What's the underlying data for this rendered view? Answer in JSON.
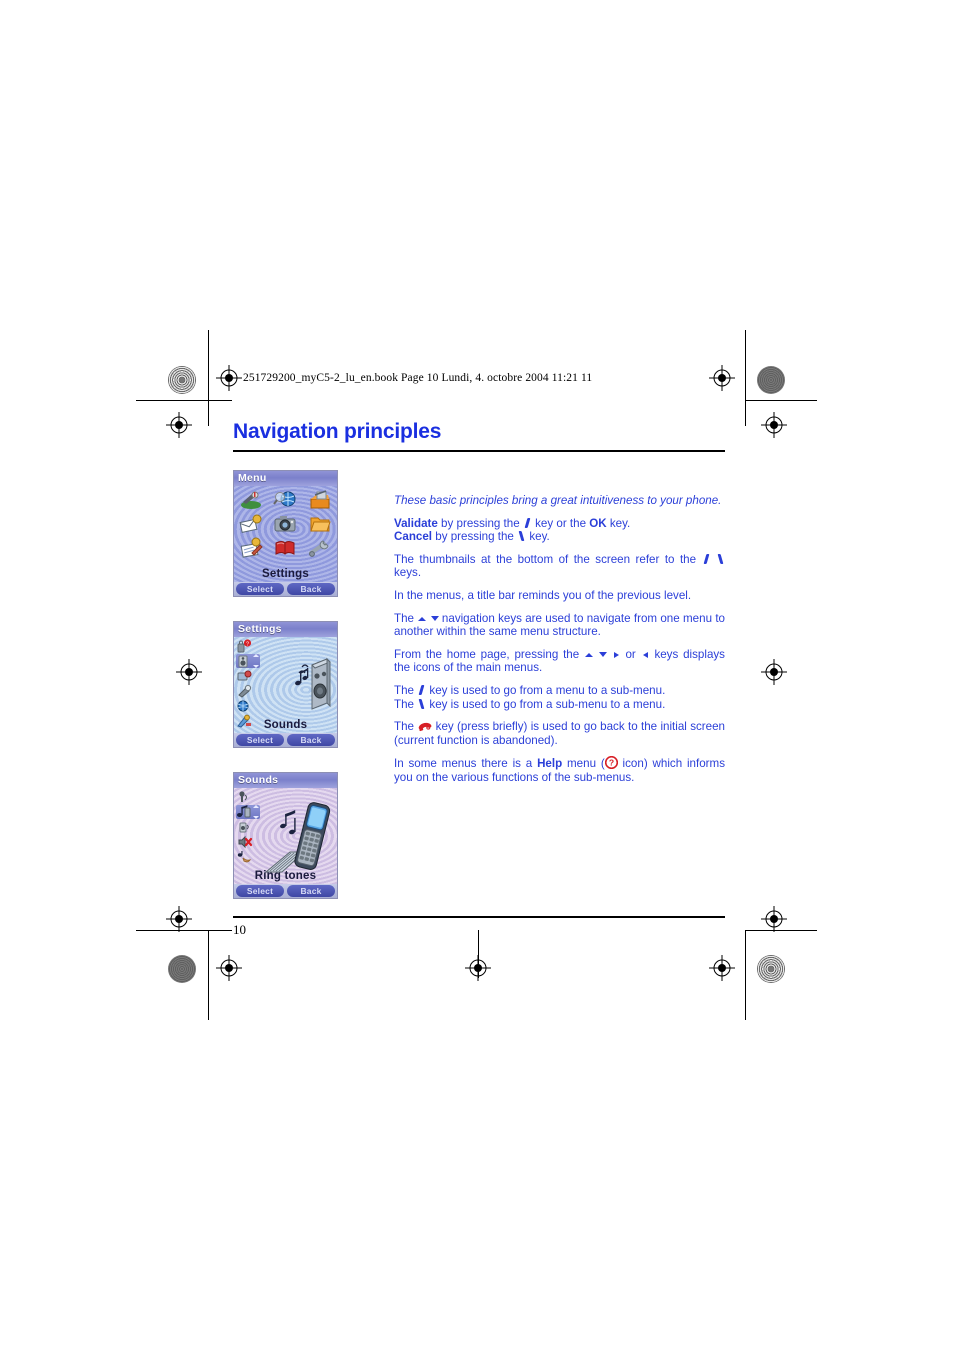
{
  "document": {
    "header_code": "251729200_myC5-2_lu_en.book  Page 10  Lundi, 4. octobre 2004  11:21 11",
    "title": "Navigation principles",
    "page_number": "10",
    "accent_color": "#1a2fe0",
    "body_color": "#2b3fd8",
    "icon_red": "#d71f26"
  },
  "body": {
    "intro": "These basic principles bring a great intuitiveness to your phone.",
    "validate_bold": "Validate",
    "validate_rest_1": " by pressing the ",
    "validate_rest_2": " key or the ",
    "ok_bold": "OK",
    "validate_rest_3": " key.",
    "cancel_bold": "Cancel",
    "cancel_rest_1": " by pressing the ",
    "cancel_rest_2": " key.",
    "thumbnails_1": "The thumbnails at the bottom of the screen refer to the ",
    "thumbnails_2": " keys.",
    "titlebar": "In the menus, a title bar reminds you of the previous level.",
    "nav_1": "The ",
    "nav_2": " navigation keys are used to navigate from one menu to another within the same menu structure.",
    "home_1": "From the home page, pressing the ",
    "home_2": " or ",
    "home_3": " keys displays the icons of the main menus.",
    "submenu_in_1": "The ",
    "submenu_in_2": " key  is used to go from a menu to a sub-menu.",
    "submenu_out_1": "The ",
    "submenu_out_2": " key is used to go from a sub-menu to a menu.",
    "hangup_1": "The ",
    "hangup_2": " key (press briefly) is used to go back to the initial screen (current function is abandoned).",
    "help_1": "In some menus there is a ",
    "help_bold": "Help",
    "help_2": " menu (",
    "help_3": " icon) which informs you on the various functions of the sub-menus."
  },
  "screens": [
    {
      "id": "menu",
      "title": "Menu",
      "label": "Settings",
      "softkey_left": "Select",
      "softkey_right": "Back",
      "icons": [
        "telephone-icon",
        "magnifier-globe-icon",
        "toolbox-icon",
        "messages-icon",
        "camera-icon",
        "folder-icon",
        "notepad-pen-icon",
        "book-icon",
        "settings-wrench-icon"
      ]
    },
    {
      "id": "settings",
      "title": "Settings",
      "label": "Sounds",
      "softkey_left": "Select",
      "softkey_right": "Back",
      "hero": "speaker-music-icon",
      "rail_icons": [
        "security-lock-icon",
        "sounds-speaker-icon",
        "display-icon",
        "network-icon",
        "language-globe-icon",
        "accessories-icon"
      ],
      "selected_index": 1
    },
    {
      "id": "sounds",
      "title": "Sounds",
      "label": "Ring tones",
      "softkey_left": "Select",
      "softkey_right": "Back",
      "hero": "mobile-phone-icon",
      "rail_icons": [
        "volume-icon",
        "ring-tones-icon",
        "alerts-icon",
        "silent-mode-icon",
        "vibrate-icon"
      ],
      "selected_index": 1
    }
  ]
}
